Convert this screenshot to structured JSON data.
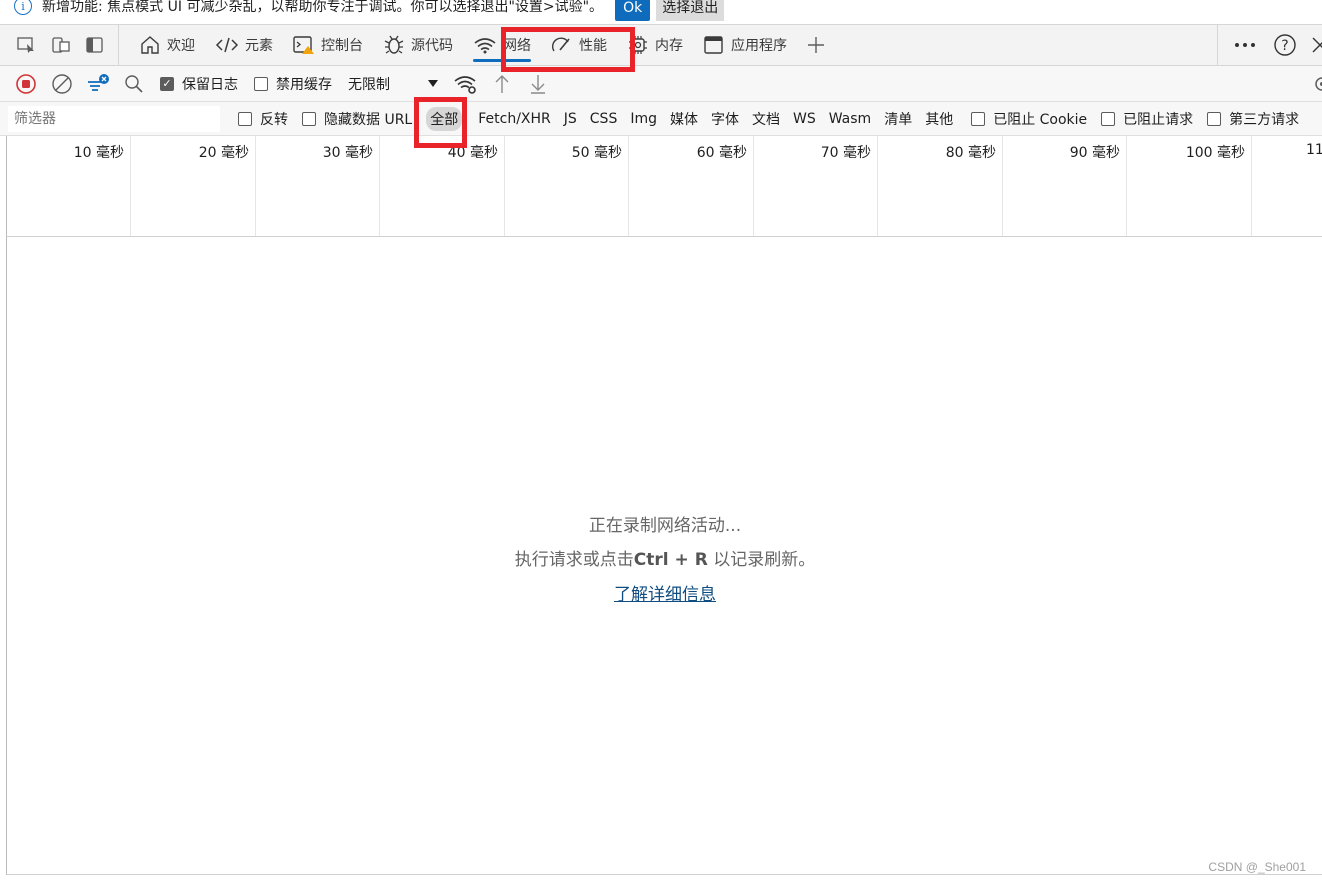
{
  "infobar": {
    "message": "新增功能: 焦点模式 UI 可减少杂乱，以帮助你专注于调试。你可以选择退出\"设置>试验\"。",
    "ok_label": "Ok",
    "exit_label": "选择退出"
  },
  "tabs": [
    {
      "label": "欢迎",
      "icon": "home-icon"
    },
    {
      "label": "元素",
      "icon": "code-icon"
    },
    {
      "label": "控制台",
      "icon": "console-warning-icon"
    },
    {
      "label": "源代码",
      "icon": "bug-icon"
    },
    {
      "label": "网络",
      "icon": "wifi-icon",
      "active": true
    },
    {
      "label": "性能",
      "icon": "gauge-icon"
    },
    {
      "label": "内存",
      "icon": "chip-icon"
    },
    {
      "label": "应用程序",
      "icon": "window-icon"
    }
  ],
  "toolbar": {
    "preserve_log": "保留日志",
    "preserve_log_checked": true,
    "disable_cache": "禁用缓存",
    "disable_cache_checked": false,
    "throttle": "无限制"
  },
  "filterbar": {
    "placeholder": "筛选器",
    "invert": "反转",
    "hide_data_urls": "隐藏数据 URL",
    "types": [
      "全部",
      "Fetch/XHR",
      "JS",
      "CSS",
      "Img",
      "媒体",
      "字体",
      "文档",
      "WS",
      "Wasm",
      "清单",
      "其他"
    ],
    "selected_type": "全部",
    "blocked_cookies": "已阻止 Cookie",
    "blocked_requests": "已阻止请求",
    "third_party": "第三方请求"
  },
  "timeline": {
    "ticks": [
      "10 毫秒",
      "20 毫秒",
      "30 毫秒",
      "40 毫秒",
      "50 毫秒",
      "60 毫秒",
      "70 毫秒",
      "80 毫秒",
      "90 毫秒",
      "100 毫秒",
      "11"
    ]
  },
  "empty_state": {
    "line1": "正在录制网络活动...",
    "line2_prefix": "执行请求或点击",
    "shortcut": "Ctrl + R",
    "line2_suffix": "以记录刷新。",
    "link": "了解详细信息"
  },
  "watermark": "CSDN @_She001",
  "colors": {
    "accent": "#0f6cbd",
    "highlight_box": "#e8232a"
  }
}
